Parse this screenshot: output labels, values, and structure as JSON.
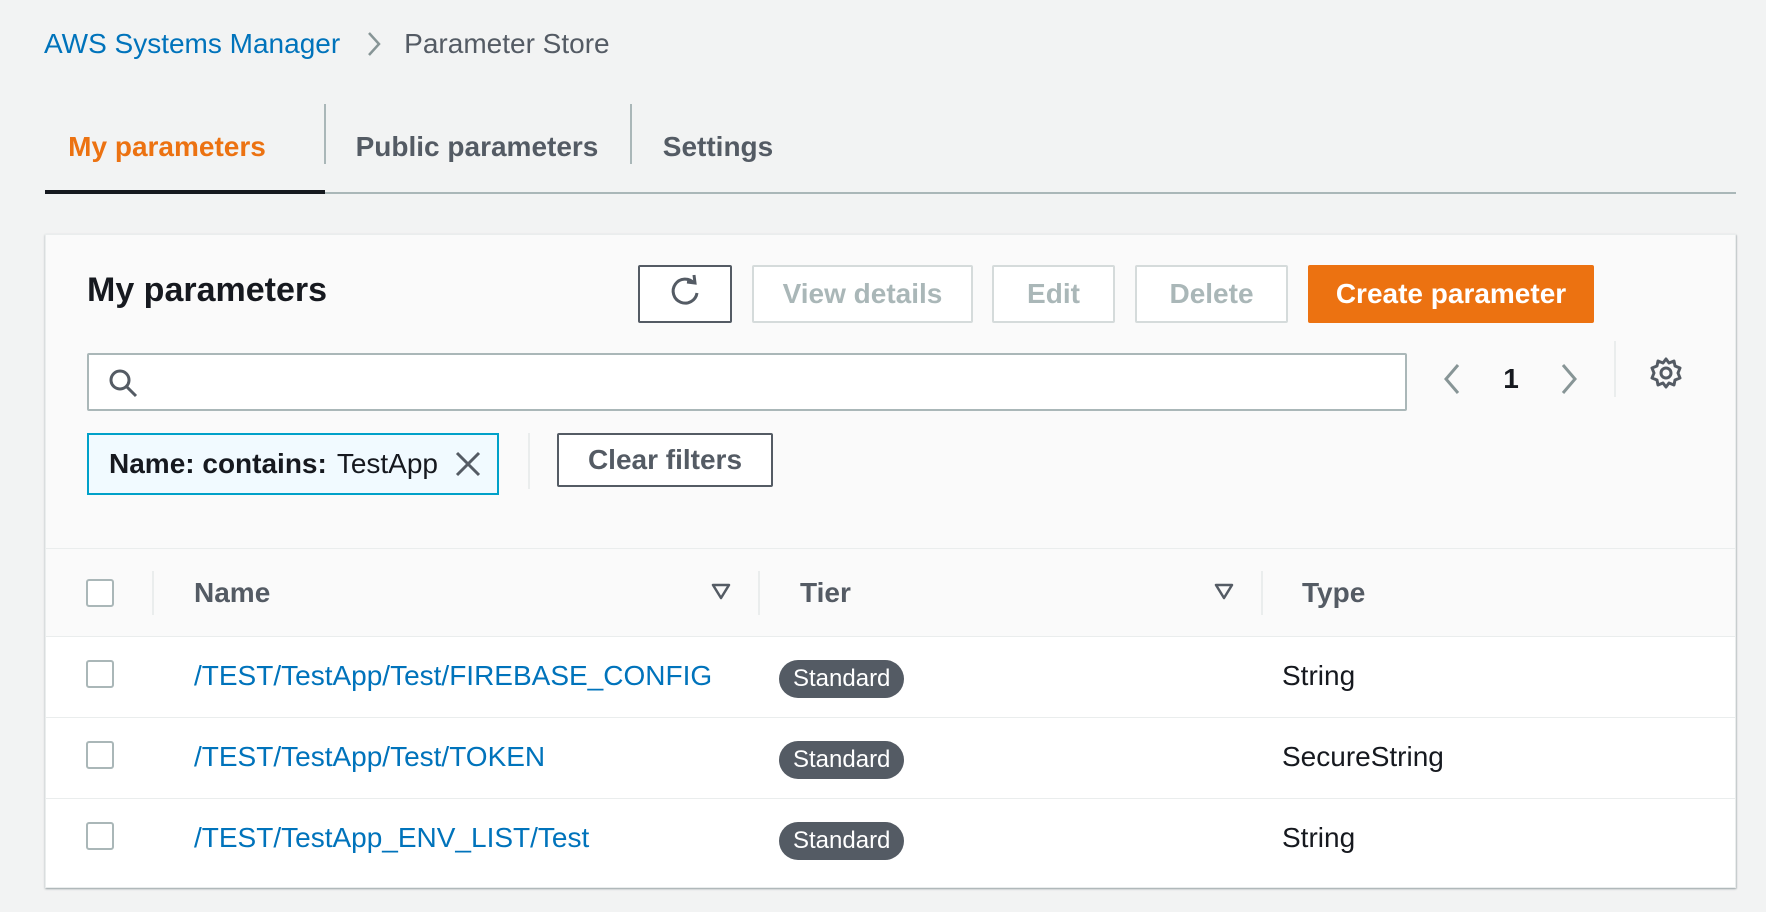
{
  "breadcrumb": {
    "parent": "AWS Systems Manager",
    "current": "Parameter Store"
  },
  "tabs": [
    {
      "label": "My parameters",
      "active": true
    },
    {
      "label": "Public parameters",
      "active": false
    },
    {
      "label": "Settings",
      "active": false
    }
  ],
  "panel": {
    "title": "My parameters",
    "buttons": {
      "refresh_icon": "refresh-icon",
      "view_details": "View details",
      "edit": "Edit",
      "delete": "Delete",
      "create": "Create parameter"
    },
    "search": {
      "value": "",
      "placeholder": ""
    },
    "pagination": {
      "current_page": "1"
    },
    "filter": {
      "key": "Name: contains:",
      "value": "TestApp"
    },
    "clear_filters": "Clear filters"
  },
  "table": {
    "columns": [
      "Name",
      "Tier",
      "Type"
    ],
    "rows": [
      {
        "name": "/TEST/TestApp/Test/FIREBASE_CONFIG",
        "tier": "Standard",
        "type": "String"
      },
      {
        "name": "/TEST/TestApp/Test/TOKEN",
        "tier": "Standard",
        "type": "SecureString"
      },
      {
        "name": "/TEST/TestApp_ENV_LIST/Test",
        "tier": "Standard",
        "type": "String"
      }
    ]
  },
  "colors": {
    "accent": "#ec7211",
    "link": "#0073bb",
    "badge": "#545b64",
    "filter_border": "#00a1c9"
  }
}
